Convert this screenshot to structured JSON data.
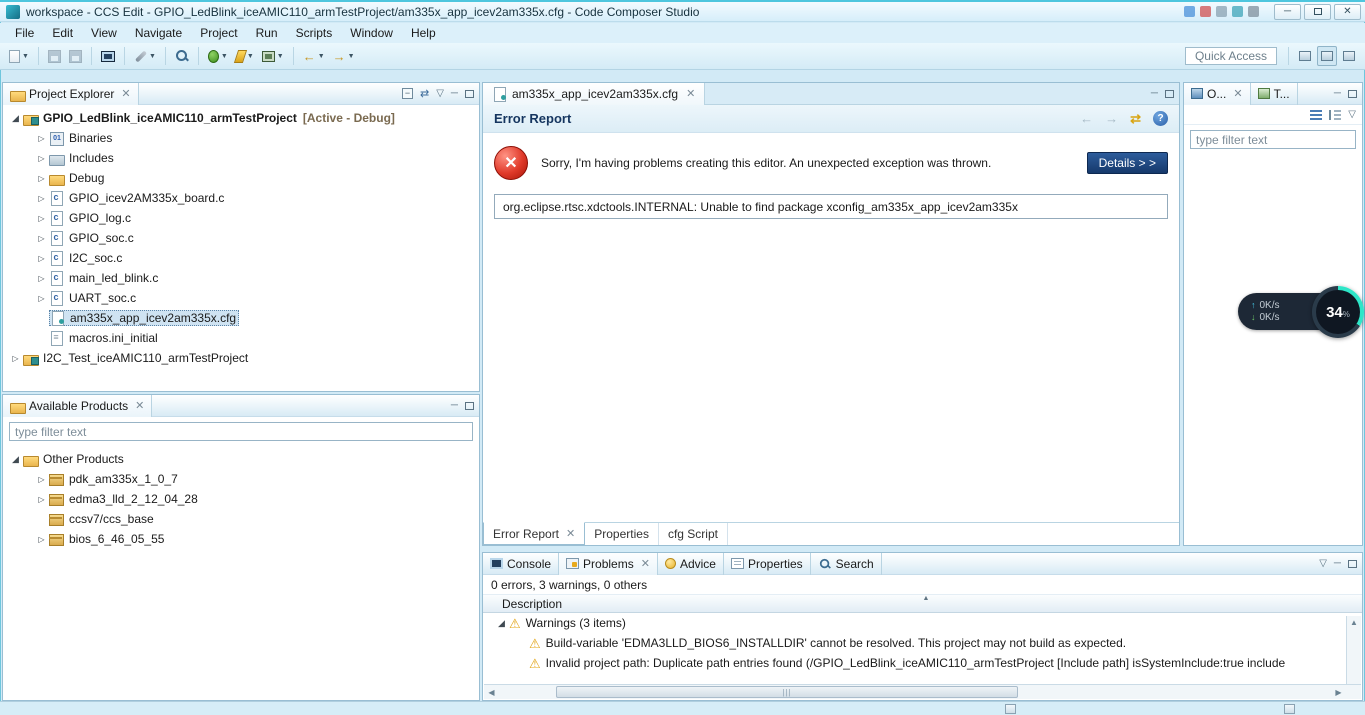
{
  "window": {
    "title": "workspace - CCS Edit - GPIO_LedBlink_iceAMIC110_armTestProject/am335x_app_icev2am335x.cfg - Code Composer Studio"
  },
  "menubar": {
    "items": [
      "File",
      "Edit",
      "View",
      "Navigate",
      "Project",
      "Run",
      "Scripts",
      "Window",
      "Help"
    ]
  },
  "toolbar": {
    "quick_access_label": "Quick Access",
    "icons": [
      "new-dropdown-icon",
      "save-icon",
      "save-all-icon",
      "console-icon",
      "build-wrench-icon",
      "search-icon",
      "debug-icon",
      "flash-icon",
      "target-chip-icon",
      "back-nav-icon",
      "forward-nav-icon"
    ],
    "perspective_icons": [
      "open-perspective-icon",
      "ccs-edit-perspective-icon",
      "ccs-debug-perspective-icon"
    ]
  },
  "project_explorer": {
    "title": "Project Explorer",
    "root": {
      "label": "GPIO_LedBlink_iceAMIC110_armTestProject",
      "badge": "[Active - Debug]"
    },
    "items": [
      {
        "label": "Binaries"
      },
      {
        "label": "Includes"
      },
      {
        "label": "Debug"
      },
      {
        "label": "GPIO_icev2AM335x_board.c"
      },
      {
        "label": "GPIO_log.c"
      },
      {
        "label": "GPIO_soc.c"
      },
      {
        "label": "I2C_soc.c"
      },
      {
        "label": "main_led_blink.c"
      },
      {
        "label": "UART_soc.c"
      },
      {
        "label": "am335x_app_icev2am335x.cfg"
      },
      {
        "label": "macros.ini_initial"
      }
    ],
    "second_project": {
      "label": "I2C_Test_iceAMIC110_armTestProject"
    }
  },
  "available_products": {
    "title": "Available Products",
    "filter_placeholder": "type filter text",
    "root": "Other Products",
    "items": [
      "pdk_am335x_1_0_7",
      "edma3_lld_2_12_04_28",
      "ccsv7/ccs_base",
      "bios_6_46_05_55"
    ]
  },
  "editor": {
    "tab": "am335x_app_icev2am335x.cfg",
    "header": "Error Report",
    "error_message": "Sorry, I'm having problems creating this editor. An unexpected exception was thrown.",
    "details_button": "Details > >",
    "exception_text": "org.eclipse.rtsc.xdctools.INTERNAL: Unable to find package xconfig_am335x_app_icev2am335x",
    "bottom_tabs": [
      "Error Report",
      "Properties",
      "cfg Script"
    ]
  },
  "problems": {
    "tabs": [
      "Console",
      "Problems",
      "Advice",
      "Properties",
      "Search"
    ],
    "summary": "0 errors, 3 warnings, 0 others",
    "column_header": "Description",
    "group_label": "Warnings (3 items)",
    "rows": [
      "Build-variable 'EDMA3LLD_BIOS6_INSTALLDIR' cannot be resolved. This project may not build as expected.",
      "Invalid project path: Duplicate path entries found (/GPIO_LedBlink_iceAMIC110_armTestProject [Include path] isSystemInclude:true include"
    ]
  },
  "right_panel": {
    "tabs": [
      "O...",
      "T..."
    ],
    "filter_placeholder": "type filter text"
  },
  "overlay": {
    "up_speed": "0K/s",
    "down_speed": "0K/s",
    "percent": "34",
    "percent_unit": "%"
  },
  "colors": {
    "titlebar_accent": "#4ec6de",
    "details_button_bg": "#16396b",
    "error_red": "#d23a2a",
    "warning_yellow": "#e2a516",
    "overlay_ring": "#2ee6c8"
  }
}
